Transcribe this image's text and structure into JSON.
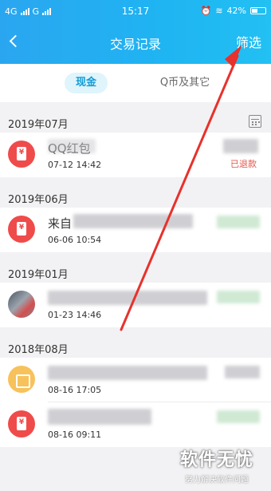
{
  "status_bar": {
    "left_label_1": "4G",
    "left_label_2": "G",
    "time": "15:17",
    "battery": "42%"
  },
  "header": {
    "title": "交易记录",
    "filter_label": "筛选"
  },
  "tabs": [
    {
      "label": "现金",
      "active": true
    },
    {
      "label": "Q币及其它",
      "active": false
    }
  ],
  "sections": [
    {
      "month": "2019年07月",
      "items": [
        {
          "name": "QQ红包",
          "date": "07-12 14:42",
          "status": "已退款",
          "icon": "red-envelope-icon"
        }
      ]
    },
    {
      "month": "2019年06月",
      "items": [
        {
          "name": "来自",
          "date": "06-06 10:54",
          "icon": "red-envelope-icon"
        }
      ]
    },
    {
      "month": "2019年01月",
      "items": [
        {
          "name": "",
          "date": "01-23 14:46",
          "icon": "avatar-photo-icon"
        }
      ]
    },
    {
      "month": "2018年08月",
      "items": [
        {
          "name": "",
          "date": "08-16 17:05",
          "icon": "shopping-bag-icon"
        },
        {
          "name": "",
          "date": "08-16 09:11",
          "icon": "red-envelope-icon"
        }
      ]
    }
  ],
  "watermark": {
    "title": "软件无忧",
    "subtitle": "努力解决软件问题"
  },
  "colors": {
    "header_start": "#2aa6f0",
    "header_end": "#22c0f3",
    "accent": "#129bd6",
    "red": "#ef4b4b",
    "arrow": "#e8312c"
  }
}
